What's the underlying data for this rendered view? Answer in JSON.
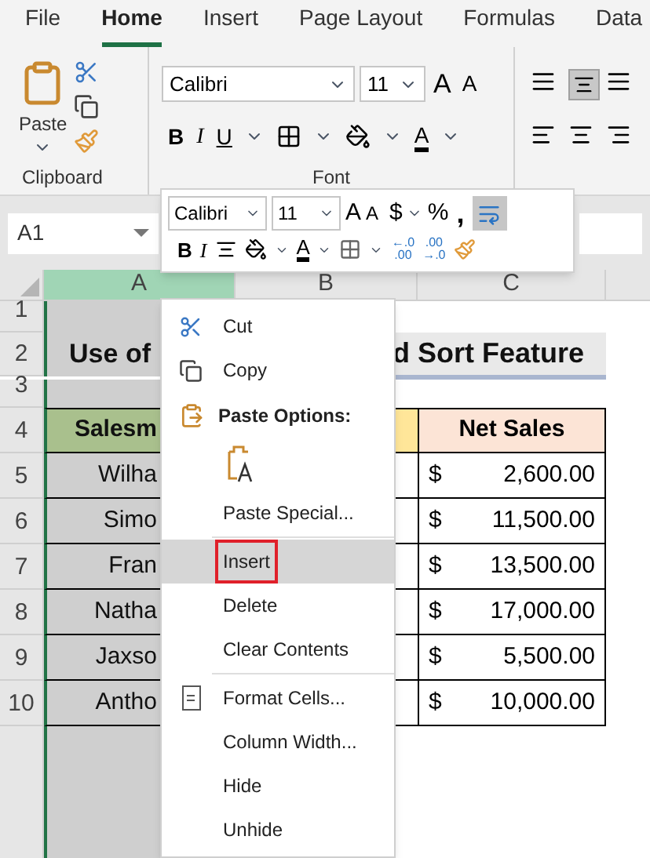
{
  "tabs": [
    {
      "label": "File",
      "selected": false
    },
    {
      "label": "Home",
      "selected": true
    },
    {
      "label": "Insert",
      "selected": false
    },
    {
      "label": "Page Layout",
      "selected": false
    },
    {
      "label": "Formulas",
      "selected": false
    },
    {
      "label": "Data",
      "selected": false
    }
  ],
  "ribbon": {
    "paste_label": "Paste",
    "clipboard_label": "Clipboard",
    "font_name": "Calibri",
    "font_size": "11",
    "grow_font": "A",
    "shrink_font": "A",
    "bold": "B",
    "italic": "I",
    "underline": "U",
    "font_color": "A",
    "font_label": "Font"
  },
  "name_box": "A1",
  "columns": [
    "A",
    "B",
    "C"
  ],
  "sheet": {
    "row_numbers": [
      "1",
      "2",
      "3",
      "4",
      "5",
      "6",
      "7",
      "8",
      "9",
      "10"
    ],
    "title_left": "Use of",
    "title_right": "d Sort Feature",
    "header_a": "Salesm",
    "header_c": "Net Sales",
    "rows": [
      {
        "name": "Wilha",
        "currency": "$",
        "amount": "2,600.00"
      },
      {
        "name": "Simo",
        "currency": "$",
        "amount": "11,500.00"
      },
      {
        "name": "Fran",
        "currency": "$",
        "amount": "13,500.00"
      },
      {
        "name": "Natha",
        "currency": "$",
        "amount": "17,000.00"
      },
      {
        "name": "Jaxso",
        "currency": "$",
        "amount": "5,500.00"
      },
      {
        "name": "Antho",
        "currency": "$",
        "amount": "10,000.00"
      }
    ]
  },
  "mini_toolbar": {
    "font_name": "Calibri",
    "font_size": "11",
    "grow_font": "A",
    "shrink_font": "A",
    "currency": "$",
    "percent": "%",
    "comma": ",",
    "wrap_selected": true,
    "bold": "B",
    "italic": "I",
    "font_color": "A",
    "decrease_decimal": {
      "top": "←.0",
      "bottom": ".00"
    },
    "increase_decimal": {
      "top": ".00",
      "bottom": "→.0"
    }
  },
  "context_menu": [
    {
      "kind": "cut",
      "label": "Cut",
      "selected": false,
      "annotated": false
    },
    {
      "kind": "copy",
      "label": "Copy",
      "selected": false,
      "annotated": false
    },
    {
      "kind": "header",
      "label": "Paste Options:"
    },
    {
      "kind": "paste-option"
    },
    {
      "kind": "item",
      "label": "Paste Special...",
      "selected": false,
      "annotated": false
    },
    {
      "kind": "separator"
    },
    {
      "kind": "item",
      "label": "Insert",
      "selected": true,
      "annotated": true
    },
    {
      "kind": "item",
      "label": "Delete",
      "selected": false,
      "annotated": false
    },
    {
      "kind": "item",
      "label": "Clear Contents",
      "selected": false,
      "annotated": false
    },
    {
      "kind": "separator"
    },
    {
      "kind": "format",
      "label": "Format Cells...",
      "selected": false,
      "annotated": false
    },
    {
      "kind": "item",
      "label": "Column Width...",
      "selected": false,
      "annotated": false
    },
    {
      "kind": "item",
      "label": "Hide",
      "selected": false,
      "annotated": false
    },
    {
      "kind": "item",
      "label": "Unhide",
      "selected": false,
      "annotated": false
    }
  ]
}
